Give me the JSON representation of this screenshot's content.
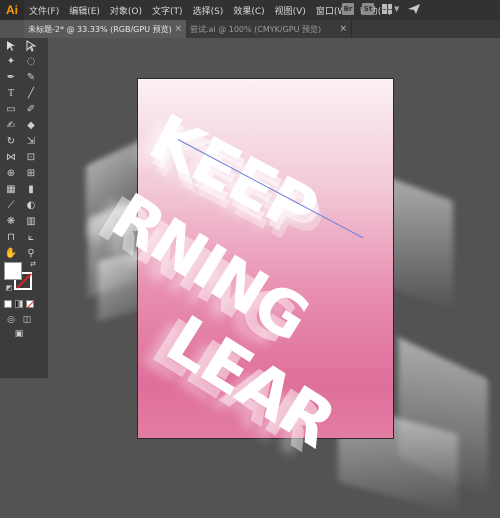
{
  "app": {
    "logo": "Ai"
  },
  "menu": [
    "文件(F)",
    "编辑(E)",
    "对象(O)",
    "文字(T)",
    "选择(S)",
    "效果(C)",
    "视图(V)",
    "窗口(W)",
    "帮助(H)"
  ],
  "menu_right": {
    "br": "Br",
    "st": "St"
  },
  "tabs": [
    {
      "label": "未标题-2* @ 33.33% (RGB/GPU 预览)",
      "close": "×"
    },
    {
      "label": "尝试.ai @ 100% (CMYK/GPU 预览)",
      "close": "×"
    }
  ],
  "artwork": {
    "line1": "KEEP",
    "line2": "RNING",
    "line3": "LEAR",
    "colors": {
      "pink_top": "#fbf0f4",
      "pink_bottom": "#df6f9b",
      "guide": "#6a7de0"
    }
  },
  "icons": [
    "selection-tool",
    "direct-selection-tool",
    "magic-wand",
    "lasso",
    "pen",
    "curvature",
    "type",
    "line",
    "rectangle",
    "paintbrush",
    "shaper",
    "eraser",
    "rotate",
    "scale",
    "width",
    "free-transform",
    "shape-builder",
    "perspective-grid",
    "mesh",
    "gradient",
    "eyedropper",
    "blend",
    "symbol-sprayer",
    "column-graph",
    "artboard",
    "slice",
    "hand",
    "zoom"
  ]
}
